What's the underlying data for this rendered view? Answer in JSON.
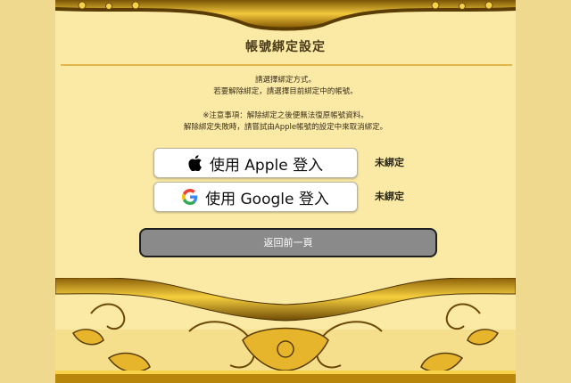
{
  "title": "帳號綁定設定",
  "info": {
    "line1": "請選擇綁定方式。",
    "line2": "若要解除綁定，請選擇目前綁定中的帳號。",
    "line3": "※注意事項：解除綁定之後便無法復原帳號資料。",
    "line4": "解除綁定失敗時，請嘗試由Apple帳號的設定中來取消綁定。"
  },
  "apple": {
    "label": "使用 Apple 登入",
    "status": "未綁定",
    "icon": "apple-icon"
  },
  "google": {
    "label": "使用 Google 登入",
    "status": "未綁定",
    "icon": "google-icon"
  },
  "back_label": "返回前一頁",
  "colors": {
    "background": "#f3e3a0",
    "panel": "#fbeaa6",
    "gold": "#c99c1f",
    "title_rule": "#e1b64a",
    "back_button": "#8a8a8a"
  }
}
